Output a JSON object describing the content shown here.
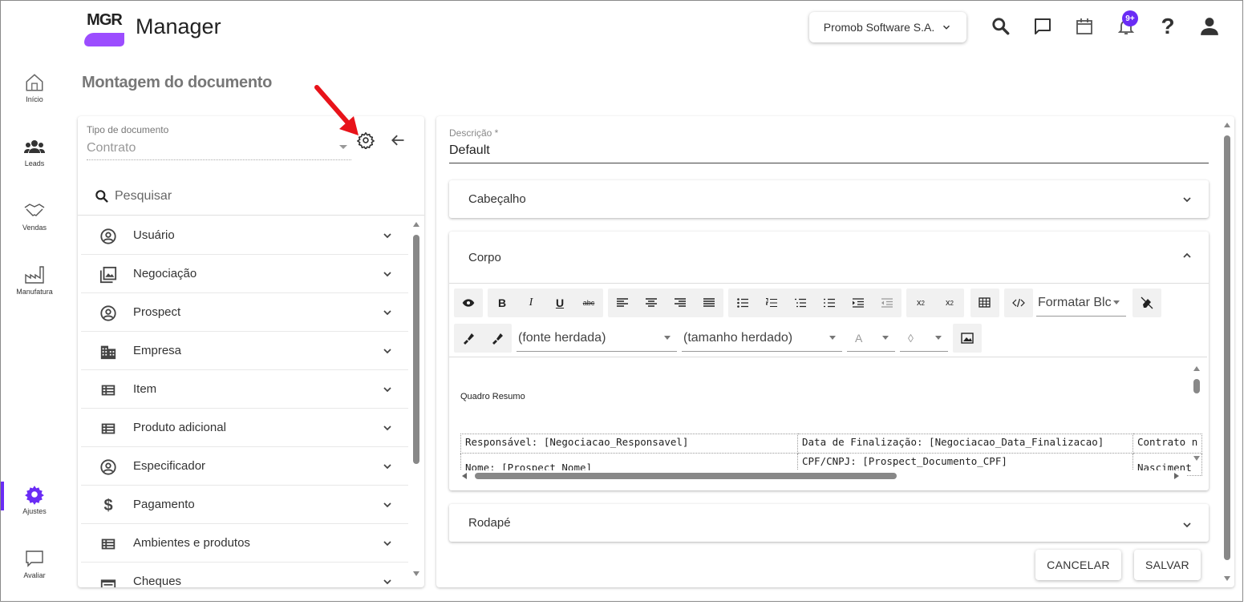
{
  "header": {
    "logo_text": "MGR",
    "app_title": "Manager",
    "company": "Promob Software S.A.",
    "notifications_badge": "9+",
    "icons": [
      "search-icon",
      "chat-icon",
      "calendar-icon",
      "bell-icon",
      "help-icon",
      "account-icon"
    ]
  },
  "nav": {
    "items": [
      {
        "label": "Início",
        "icon": "home-icon"
      },
      {
        "label": "Leads",
        "icon": "people-icon"
      },
      {
        "label": "Vendas",
        "icon": "handshake-icon"
      },
      {
        "label": "Manufatura",
        "icon": "factory-icon"
      },
      {
        "label": "Ajustes",
        "icon": "gear-icon",
        "active": true
      },
      {
        "label": "Avaliar",
        "icon": "feedback-icon"
      }
    ]
  },
  "page_title": "Montagem do documento",
  "left_panel": {
    "tipo_label": "Tipo de documento",
    "tipo_value": "Contrato",
    "search_placeholder": "Pesquisar",
    "items": [
      {
        "label": "Usuário",
        "icon": "account-circle-icon"
      },
      {
        "label": "Negociação",
        "icon": "image-stack-icon"
      },
      {
        "label": "Prospect",
        "icon": "account-circle-icon"
      },
      {
        "label": "Empresa",
        "icon": "building-icon"
      },
      {
        "label": "Item",
        "icon": "list-icon"
      },
      {
        "label": "Produto adicional",
        "icon": "list-icon"
      },
      {
        "label": "Especificador",
        "icon": "account-circle-icon"
      },
      {
        "label": "Pagamento",
        "icon": "dollar-icon"
      },
      {
        "label": "Ambientes e produtos",
        "icon": "list-icon"
      },
      {
        "label": "Cheques",
        "icon": "check-table-icon"
      }
    ]
  },
  "right_panel": {
    "desc_label": "Descrição *",
    "desc_value": "Default",
    "sections": {
      "header": "Cabeçalho",
      "body": "Corpo",
      "footer": "Rodapé"
    },
    "toolbar": {
      "bold": "B",
      "italic": "I",
      "underline": "U",
      "strike": "abc",
      "format_block": "Formatar Blc",
      "font": "(fonte herdada)",
      "size": "(tamanho herdado)",
      "font_color": "A",
      "bg_color": "◊"
    },
    "content": {
      "quadro": "Quadro Resumo",
      "rows": [
        [
          "Responsável: [Negociacao_Responsavel]",
          "Data de Finalização: [Negociacao_Data_Finalizacao]",
          "Contrato n"
        ],
        [
          "Nome: [Prospect_Nome]",
          "CPF/CNPJ: [Prospect_Documento_CPF]",
          "Nasciment"
        ]
      ]
    },
    "cancel": "CANCELAR",
    "save": "SALVAR"
  },
  "colors": {
    "accent": "#6a2cf5",
    "logo_purple": "#9c4dff",
    "annotation_arrow": "#e8131a"
  }
}
